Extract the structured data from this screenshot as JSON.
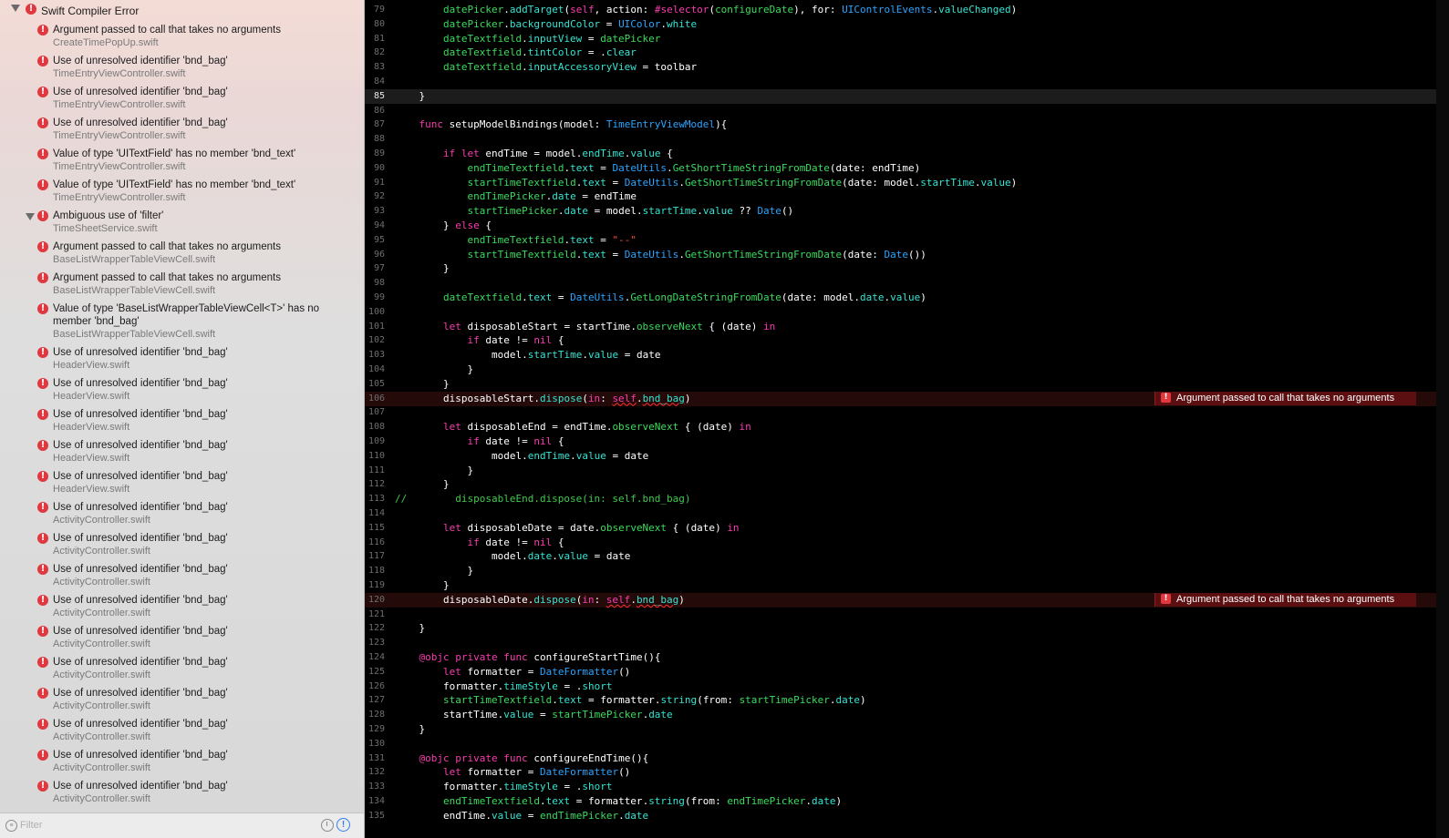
{
  "navigator": {
    "group_title": "Swift Compiler Error",
    "issues": [
      {
        "message": "Argument passed to call that takes no arguments",
        "file": "CreateTimePopUp.swift"
      },
      {
        "message": "Use of unresolved identifier 'bnd_bag'",
        "file": "TimeEntryViewController.swift"
      },
      {
        "message": "Use of unresolved identifier 'bnd_bag'",
        "file": "TimeEntryViewController.swift"
      },
      {
        "message": "Use of unresolved identifier 'bnd_bag'",
        "file": "TimeEntryViewController.swift"
      },
      {
        "message": "Value of type 'UITextField' has no member 'bnd_text'",
        "file": "TimeEntryViewController.swift"
      },
      {
        "message": "Value of type 'UITextField' has no member 'bnd_text'",
        "file": "TimeEntryViewController.swift"
      },
      {
        "message": "Ambiguous use of 'filter'",
        "file": "TimeSheetService.swift"
      },
      {
        "message": "Argument passed to call that takes no arguments",
        "file": "BaseListWrapperTableViewCell.swift"
      },
      {
        "message": "Argument passed to call that takes no arguments",
        "file": "BaseListWrapperTableViewCell.swift"
      },
      {
        "message": "Value of type 'BaseListWrapperTableViewCell<T>' has no member 'bnd_bag'",
        "file": "BaseListWrapperTableViewCell.swift"
      },
      {
        "message": "Use of unresolved identifier 'bnd_bag'",
        "file": "HeaderView.swift"
      },
      {
        "message": "Use of unresolved identifier 'bnd_bag'",
        "file": "HeaderView.swift"
      },
      {
        "message": "Use of unresolved identifier 'bnd_bag'",
        "file": "HeaderView.swift"
      },
      {
        "message": "Use of unresolved identifier 'bnd_bag'",
        "file": "HeaderView.swift"
      },
      {
        "message": "Use of unresolved identifier 'bnd_bag'",
        "file": "HeaderView.swift"
      },
      {
        "message": "Use of unresolved identifier 'bnd_bag'",
        "file": "ActivityController.swift"
      },
      {
        "message": "Use of unresolved identifier 'bnd_bag'",
        "file": "ActivityController.swift"
      },
      {
        "message": "Use of unresolved identifier 'bnd_bag'",
        "file": "ActivityController.swift"
      },
      {
        "message": "Use of unresolved identifier 'bnd_bag'",
        "file": "ActivityController.swift"
      },
      {
        "message": "Use of unresolved identifier 'bnd_bag'",
        "file": "ActivityController.swift"
      },
      {
        "message": "Use of unresolved identifier 'bnd_bag'",
        "file": "ActivityController.swift"
      },
      {
        "message": "Use of unresolved identifier 'bnd_bag'",
        "file": "ActivityController.swift"
      },
      {
        "message": "Use of unresolved identifier 'bnd_bag'",
        "file": "ActivityController.swift"
      },
      {
        "message": "Use of unresolved identifier 'bnd_bag'",
        "file": "ActivityController.swift"
      },
      {
        "message": "Use of unresolved identifier 'bnd_bag'",
        "file": "ActivityController.swift"
      }
    ],
    "filter_placeholder": "Filter"
  },
  "editor": {
    "current_line": 85,
    "lines": [
      {
        "n": 79,
        "code": "        datePicker.addTarget(self, action: #selector(configureDate), for: UIControlEvents.valueChanged)"
      },
      {
        "n": 80,
        "code": "        datePicker.backgroundColor = UIColor.white"
      },
      {
        "n": 81,
        "code": "        dateTextfield.inputView = datePicker"
      },
      {
        "n": 82,
        "code": "        dateTextfield.tintColor = .clear"
      },
      {
        "n": 83,
        "code": "        dateTextfield.inputAccessoryView = toolbar"
      },
      {
        "n": 84,
        "code": ""
      },
      {
        "n": 85,
        "code": "    }"
      },
      {
        "n": 86,
        "code": ""
      },
      {
        "n": 87,
        "code": "    func setupModelBindings(model: TimeEntryViewModel){"
      },
      {
        "n": 88,
        "code": ""
      },
      {
        "n": 89,
        "code": "        if let endTime = model.endTime.value {"
      },
      {
        "n": 90,
        "code": "            endTimeTextfield.text = DateUtils.GetShortTimeStringFromDate(date: endTime)"
      },
      {
        "n": 91,
        "code": "            startTimeTextfield.text = DateUtils.GetShortTimeStringFromDate(date: model.startTime.value)"
      },
      {
        "n": 92,
        "code": "            endTimePicker.date = endTime"
      },
      {
        "n": 93,
        "code": "            startTimePicker.date = model.startTime.value ?? Date()"
      },
      {
        "n": 94,
        "code": "        } else {"
      },
      {
        "n": 95,
        "code": "            endTimeTextfield.text = \"--\""
      },
      {
        "n": 96,
        "code": "            startTimeTextfield.text = DateUtils.GetShortTimeStringFromDate(date: Date())"
      },
      {
        "n": 97,
        "code": "        }"
      },
      {
        "n": 98,
        "code": ""
      },
      {
        "n": 99,
        "code": "        dateTextfield.text = DateUtils.GetLongDateStringFromDate(date: model.date.value)"
      },
      {
        "n": 100,
        "code": ""
      },
      {
        "n": 101,
        "code": "        let disposableStart = startTime.observeNext { (date) in"
      },
      {
        "n": 102,
        "code": "            if date != nil {"
      },
      {
        "n": 103,
        "code": "                model.startTime.value = date"
      },
      {
        "n": 104,
        "code": "            }"
      },
      {
        "n": 105,
        "code": "        }"
      },
      {
        "n": 106,
        "code": "        disposableStart.dispose(in: self.bnd_bag)",
        "error": "Argument passed to call that takes no arguments"
      },
      {
        "n": 107,
        "code": ""
      },
      {
        "n": 108,
        "code": "        let disposableEnd = endTime.observeNext { (date) in"
      },
      {
        "n": 109,
        "code": "            if date != nil {"
      },
      {
        "n": 110,
        "code": "                model.endTime.value = date"
      },
      {
        "n": 111,
        "code": "            }"
      },
      {
        "n": 112,
        "code": "        }"
      },
      {
        "n": 113,
        "code": "//        disposableEnd.dispose(in: self.bnd_bag)"
      },
      {
        "n": 114,
        "code": ""
      },
      {
        "n": 115,
        "code": "        let disposableDate = date.observeNext { (date) in"
      },
      {
        "n": 116,
        "code": "            if date != nil {"
      },
      {
        "n": 117,
        "code": "                model.date.value = date"
      },
      {
        "n": 118,
        "code": "            }"
      },
      {
        "n": 119,
        "code": "        }"
      },
      {
        "n": 120,
        "code": "        disposableDate.dispose(in: self.bnd_bag)",
        "error": "Argument passed to call that takes no arguments"
      },
      {
        "n": 121,
        "code": ""
      },
      {
        "n": 122,
        "code": "    }"
      },
      {
        "n": 123,
        "code": ""
      },
      {
        "n": 124,
        "code": "    @objc private func configureStartTime(){"
      },
      {
        "n": 125,
        "code": "        let formatter = DateFormatter()"
      },
      {
        "n": 126,
        "code": "        formatter.timeStyle = .short"
      },
      {
        "n": 127,
        "code": "        startTimeTextfield.text = formatter.string(from: startTimePicker.date)"
      },
      {
        "n": 128,
        "code": "        startTime.value = startTimePicker.date"
      },
      {
        "n": 129,
        "code": "    }"
      },
      {
        "n": 130,
        "code": ""
      },
      {
        "n": 131,
        "code": "    @objc private func configureEndTime(){"
      },
      {
        "n": 132,
        "code": "        let formatter = DateFormatter()"
      },
      {
        "n": 133,
        "code": "        formatter.timeStyle = .short"
      },
      {
        "n": 134,
        "code": "        endTimeTextfield.text = formatter.string(from: endTimePicker.date)"
      },
      {
        "n": 135,
        "code": "        endTime.value = endTimePicker.date"
      }
    ]
  }
}
